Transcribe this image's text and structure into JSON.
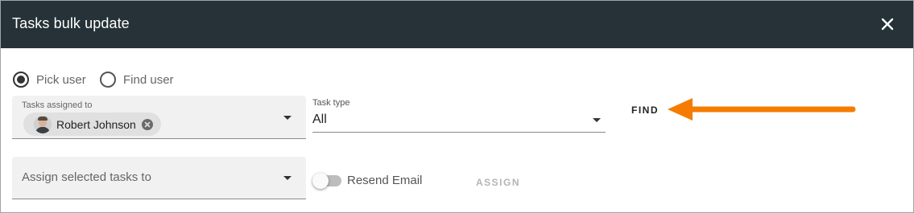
{
  "dialog": {
    "title": "Tasks bulk update",
    "close_icon": "close-icon"
  },
  "mode": {
    "options": [
      {
        "label": "Pick user",
        "selected": true
      },
      {
        "label": "Find user",
        "selected": false
      }
    ]
  },
  "tasks_assigned_to": {
    "label": "Tasks assigned to",
    "chips": [
      {
        "name": "Robert Johnson",
        "icon": "user-avatar"
      }
    ]
  },
  "task_type": {
    "label": "Task type",
    "value": "All"
  },
  "find_button": {
    "label": "FIND"
  },
  "assign_selected": {
    "placeholder": "Assign selected tasks to"
  },
  "resend_email": {
    "label": "Resend Email",
    "on": false
  },
  "assign_button": {
    "label": "ASSIGN",
    "disabled": true
  },
  "colors": {
    "header_bg": "#263238",
    "annotation_arrow": "#f57c00"
  }
}
